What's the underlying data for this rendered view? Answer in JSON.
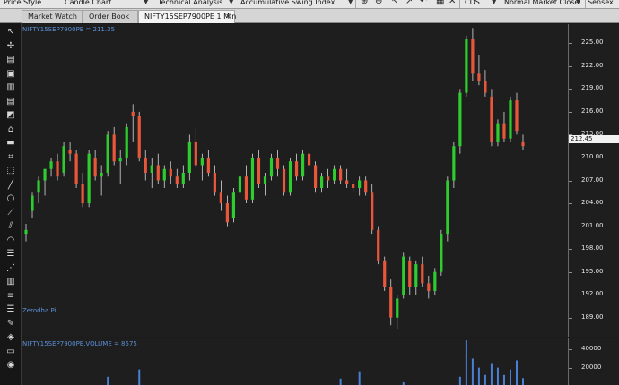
{
  "toolbar": {
    "price_style": "Price Style",
    "candle_chart": "Candle Chart",
    "technical_analysis": "Technical Analysis",
    "indicator": "Accumulative Swing Index",
    "exchange": "CDS",
    "close_type": "Normal Market Close",
    "sensex": "Sensex"
  },
  "tabs": [
    {
      "label": "Market Watch"
    },
    {
      "label": "Order Book"
    },
    {
      "label": "NIFTY15SEP7900PE 1 Min"
    }
  ],
  "tab_close": "✕",
  "price_pane": {
    "label": "NIFTY15SEP7900PE = 211.35",
    "watermark": "Zerodha Pi",
    "last_price_label": "212.45"
  },
  "volume_pane": {
    "label": "NIFTY15SEP7900PE.VOLUME = 8575"
  },
  "colors": {
    "up": "#2ecc2e",
    "down": "#e8573a",
    "volume": "#4a7fd6",
    "label": "#5b8fd6"
  },
  "sidebar_icons": [
    "cursor-icon",
    "crosshair-icon",
    "save-icon",
    "floppy-icon",
    "chart-icon",
    "book-icon",
    "eraser-icon",
    "home-icon",
    "rectangle-icon",
    "brackets-icon",
    "select-icon",
    "line-icon",
    "ellipse-icon",
    "trendline-icon",
    "channel-icon",
    "arc-icon",
    "fibonacci-icon",
    "fan-icon",
    "bars-icon",
    "lines-icon",
    "list-icon",
    "pencil-icon",
    "layers-icon",
    "window-icon",
    "eye-icon"
  ],
  "chart_data": {
    "type": "candlestick",
    "price_axis": {
      "ticks": [
        "225.00",
        "222.00",
        "219.00",
        "216.00",
        "213.00",
        "210.00",
        "207.00",
        "204.00",
        "201.00",
        "198.00",
        "195.00",
        "192.00",
        "189.00"
      ],
      "min": 186.5,
      "max": 227.5
    },
    "volume_axis": {
      "ticks": [
        "40000",
        "20000"
      ],
      "max": 52000
    },
    "candles": [
      {
        "o": 200.0,
        "h": 201.3,
        "l": 199.0,
        "c": 200.5,
        "v": 0
      },
      {
        "o": 203.0,
        "h": 205.5,
        "l": 202.0,
        "c": 205.0,
        "v": 0
      },
      {
        "o": 205.5,
        "h": 207.5,
        "l": 204.0,
        "c": 207.0,
        "v": 0
      },
      {
        "o": 207.0,
        "h": 208.5,
        "l": 205.0,
        "c": 208.5,
        "v": 0
      },
      {
        "o": 208.5,
        "h": 210.0,
        "l": 207.5,
        "c": 209.5,
        "v": 0
      },
      {
        "o": 209.5,
        "h": 210.5,
        "l": 207.0,
        "c": 207.5,
        "v": 0
      },
      {
        "o": 208.0,
        "h": 212.0,
        "l": 207.5,
        "c": 211.5,
        "v": 0
      },
      {
        "o": 211.0,
        "h": 212.0,
        "l": 209.5,
        "c": 210.5,
        "v": 0
      },
      {
        "o": 210.5,
        "h": 211.0,
        "l": 206.0,
        "c": 206.5,
        "v": 0
      },
      {
        "o": 206.5,
        "h": 208.0,
        "l": 203.5,
        "c": 204.0,
        "v": 0
      },
      {
        "o": 204.0,
        "h": 211.0,
        "l": 203.5,
        "c": 210.5,
        "v": 0
      },
      {
        "o": 210.0,
        "h": 211.0,
        "l": 207.0,
        "c": 207.5,
        "v": 0
      },
      {
        "o": 207.5,
        "h": 209.0,
        "l": 205.0,
        "c": 208.0,
        "v": 0
      },
      {
        "o": 208.0,
        "h": 213.5,
        "l": 207.5,
        "c": 213.0,
        "v": 0
      },
      {
        "o": 213.0,
        "h": 214.0,
        "l": 209.0,
        "c": 209.5,
        "v": 0
      },
      {
        "o": 209.5,
        "h": 211.0,
        "l": 206.5,
        "c": 210.0,
        "v": 0
      },
      {
        "o": 210.0,
        "h": 214.5,
        "l": 209.0,
        "c": 214.0,
        "v": 0
      },
      {
        "o": 216.0,
        "h": 217.0,
        "l": 212.0,
        "c": 215.5,
        "v": 0
      },
      {
        "o": 215.5,
        "h": 216.0,
        "l": 209.5,
        "c": 210.0,
        "v": 0
      },
      {
        "o": 210.0,
        "h": 211.0,
        "l": 207.0,
        "c": 208.0,
        "v": 0
      },
      {
        "o": 208.0,
        "h": 210.0,
        "l": 206.0,
        "c": 209.0,
        "v": 0
      },
      {
        "o": 209.0,
        "h": 210.5,
        "l": 206.5,
        "c": 207.0,
        "v": 0
      },
      {
        "o": 207.0,
        "h": 209.0,
        "l": 206.0,
        "c": 208.5,
        "v": 0
      },
      {
        "o": 208.5,
        "h": 209.5,
        "l": 206.5,
        "c": 207.5,
        "v": 0
      },
      {
        "o": 207.5,
        "h": 208.5,
        "l": 206.0,
        "c": 206.5,
        "v": 0
      },
      {
        "o": 206.5,
        "h": 209.0,
        "l": 206.0,
        "c": 208.0,
        "v": 0
      },
      {
        "o": 208.0,
        "h": 213.0,
        "l": 207.0,
        "c": 212.0,
        "v": 0
      },
      {
        "o": 212.0,
        "h": 214.0,
        "l": 208.5,
        "c": 209.0,
        "v": 0
      },
      {
        "o": 209.0,
        "h": 210.5,
        "l": 207.0,
        "c": 210.0,
        "v": 0
      },
      {
        "o": 210.0,
        "h": 211.0,
        "l": 207.5,
        "c": 208.0,
        "v": 0
      },
      {
        "o": 208.0,
        "h": 209.0,
        "l": 205.0,
        "c": 205.5,
        "v": 0
      },
      {
        "o": 205.5,
        "h": 207.0,
        "l": 203.0,
        "c": 204.0,
        "v": 0
      },
      {
        "o": 204.0,
        "h": 205.0,
        "l": 201.0,
        "c": 201.5,
        "v": 0
      },
      {
        "o": 202.0,
        "h": 206.0,
        "l": 201.5,
        "c": 205.5,
        "v": 0
      },
      {
        "o": 205.5,
        "h": 208.0,
        "l": 204.5,
        "c": 207.5,
        "v": 0
      },
      {
        "o": 207.5,
        "h": 209.0,
        "l": 204.0,
        "c": 204.5,
        "v": 0
      },
      {
        "o": 204.5,
        "h": 210.5,
        "l": 204.0,
        "c": 210.0,
        "v": 0
      },
      {
        "o": 210.0,
        "h": 211.0,
        "l": 206.0,
        "c": 206.5,
        "v": 0
      },
      {
        "o": 206.5,
        "h": 208.0,
        "l": 205.0,
        "c": 207.5,
        "v": 0
      },
      {
        "o": 207.5,
        "h": 210.5,
        "l": 207.0,
        "c": 210.0,
        "v": 0
      },
      {
        "o": 210.0,
        "h": 211.0,
        "l": 207.5,
        "c": 208.5,
        "v": 0
      },
      {
        "o": 208.5,
        "h": 209.0,
        "l": 205.0,
        "c": 205.5,
        "v": 0
      },
      {
        "o": 205.5,
        "h": 210.0,
        "l": 205.0,
        "c": 209.5,
        "v": 0
      },
      {
        "o": 209.5,
        "h": 210.5,
        "l": 207.0,
        "c": 207.5,
        "v": 0
      },
      {
        "o": 207.5,
        "h": 211.0,
        "l": 207.0,
        "c": 210.5,
        "v": 0
      },
      {
        "o": 210.5,
        "h": 211.5,
        "l": 208.5,
        "c": 209.0,
        "v": 0
      },
      {
        "o": 209.0,
        "h": 209.5,
        "l": 205.5,
        "c": 206.0,
        "v": 0
      },
      {
        "o": 206.0,
        "h": 208.0,
        "l": 205.5,
        "c": 207.5,
        "v": 0
      },
      {
        "o": 207.5,
        "h": 208.5,
        "l": 206.0,
        "c": 207.0,
        "v": 0
      },
      {
        "o": 207.0,
        "h": 209.0,
        "l": 206.5,
        "c": 208.5,
        "v": 0
      },
      {
        "o": 208.5,
        "h": 209.0,
        "l": 206.5,
        "c": 207.0,
        "v": 0
      },
      {
        "o": 207.0,
        "h": 208.5,
        "l": 206.0,
        "c": 206.5,
        "v": 0
      },
      {
        "o": 206.5,
        "h": 207.0,
        "l": 205.5,
        "c": 206.0,
        "v": 0
      },
      {
        "o": 206.0,
        "h": 207.5,
        "l": 205.0,
        "c": 207.0,
        "v": 0
      },
      {
        "o": 207.0,
        "h": 207.5,
        "l": 205.0,
        "c": 205.5,
        "v": 0
      },
      {
        "o": 205.5,
        "h": 206.5,
        "l": 200.0,
        "c": 200.5,
        "v": 0
      },
      {
        "o": 200.5,
        "h": 201.0,
        "l": 196.0,
        "c": 196.5,
        "v": 0
      },
      {
        "o": 196.5,
        "h": 197.0,
        "l": 192.5,
        "c": 193.0,
        "v": 0
      },
      {
        "o": 193.0,
        "h": 194.0,
        "l": 188.0,
        "c": 189.0,
        "v": 0
      },
      {
        "o": 189.0,
        "h": 192.0,
        "l": 187.5,
        "c": 191.5,
        "v": 0
      },
      {
        "o": 192.0,
        "h": 197.5,
        "l": 191.5,
        "c": 197.0,
        "v": 0
      },
      {
        "o": 196.5,
        "h": 197.0,
        "l": 192.0,
        "c": 193.0,
        "v": 0
      },
      {
        "o": 193.0,
        "h": 196.5,
        "l": 192.0,
        "c": 196.0,
        "v": 0
      },
      {
        "o": 196.0,
        "h": 197.0,
        "l": 193.0,
        "c": 193.5,
        "v": 0
      },
      {
        "o": 193.5,
        "h": 194.5,
        "l": 191.5,
        "c": 192.5,
        "v": 0
      },
      {
        "o": 192.5,
        "h": 195.5,
        "l": 192.0,
        "c": 195.0,
        "v": 0
      },
      {
        "o": 195.0,
        "h": 200.5,
        "l": 194.5,
        "c": 200.0,
        "v": 0
      },
      {
        "o": 200.0,
        "h": 207.5,
        "l": 199.0,
        "c": 207.0,
        "v": 0
      },
      {
        "o": 207.0,
        "h": 212.0,
        "l": 206.0,
        "c": 211.5,
        "v": 0
      },
      {
        "o": 211.5,
        "h": 219.0,
        "l": 210.5,
        "c": 218.5,
        "v": 10000
      },
      {
        "o": 218.5,
        "h": 226.0,
        "l": 218.0,
        "c": 225.5,
        "v": 50000
      },
      {
        "o": 225.5,
        "h": 227.0,
        "l": 220.0,
        "c": 221.0,
        "v": 30000
      },
      {
        "o": 221.0,
        "h": 223.5,
        "l": 219.5,
        "c": 220.0,
        "v": 20000
      },
      {
        "o": 220.0,
        "h": 221.5,
        "l": 218.0,
        "c": 218.5,
        "v": 12000
      },
      {
        "o": 218.0,
        "h": 219.0,
        "l": 211.5,
        "c": 212.0,
        "v": 25000
      },
      {
        "o": 212.0,
        "h": 215.0,
        "l": 211.5,
        "c": 214.5,
        "v": 20000
      },
      {
        "o": 214.5,
        "h": 216.0,
        "l": 212.0,
        "c": 212.5,
        "v": 12000
      },
      {
        "o": 212.5,
        "h": 218.0,
        "l": 212.0,
        "c": 217.5,
        "v": 18000
      },
      {
        "o": 217.5,
        "h": 218.5,
        "l": 213.0,
        "c": 213.5,
        "v": 28000
      },
      {
        "o": 212.0,
        "h": 213.0,
        "l": 211.0,
        "c": 211.5,
        "v": 8575
      }
    ],
    "volume_bars_extra": [
      {
        "index": 18,
        "v": 18000
      },
      {
        "index": 13,
        "v": 10000
      },
      {
        "index": 50,
        "v": 8000
      },
      {
        "index": 53,
        "v": 16000
      },
      {
        "index": 60,
        "v": 4000
      }
    ]
  }
}
